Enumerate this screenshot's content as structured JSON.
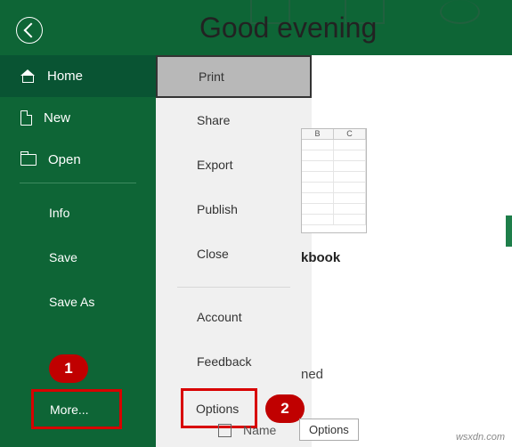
{
  "greeting": "Good evening",
  "sidebar": {
    "home": "Home",
    "new": "New",
    "open": "Open",
    "info": "Info",
    "save": "Save",
    "save_as": "Save As",
    "more": "More..."
  },
  "flyout": {
    "print": "Print",
    "share": "Share",
    "export": "Export",
    "publish": "Publish",
    "close": "Close",
    "account": "Account",
    "feedback": "Feedback",
    "options": "Options"
  },
  "content": {
    "columns": [
      "B",
      "C"
    ],
    "workbook_label": "kbook",
    "pinned_text": "ned",
    "name_label": "Name",
    "tooltip": "Options"
  },
  "badges": {
    "one": "1",
    "two": "2"
  },
  "watermark": "wsxdn.com",
  "colors": {
    "primary": "#0e6536",
    "accent_red": "#d80000",
    "badge": "#c00000"
  }
}
